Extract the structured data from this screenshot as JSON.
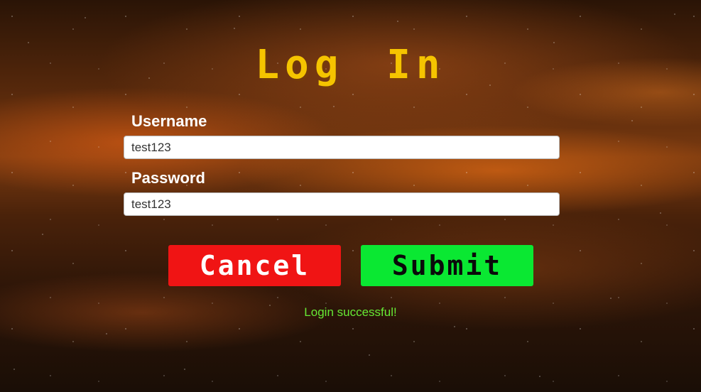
{
  "title": "Log In",
  "form": {
    "username_label": "Username",
    "username_value": "test123",
    "password_label": "Password",
    "password_value": "test123"
  },
  "buttons": {
    "cancel_label": "Cancel",
    "submit_label": "Submit"
  },
  "status_message": "Login successful!",
  "colors": {
    "title": "#f5c400",
    "cancel_button": "#f01414",
    "submit_button": "#0ae832",
    "status_text": "#66e834"
  }
}
